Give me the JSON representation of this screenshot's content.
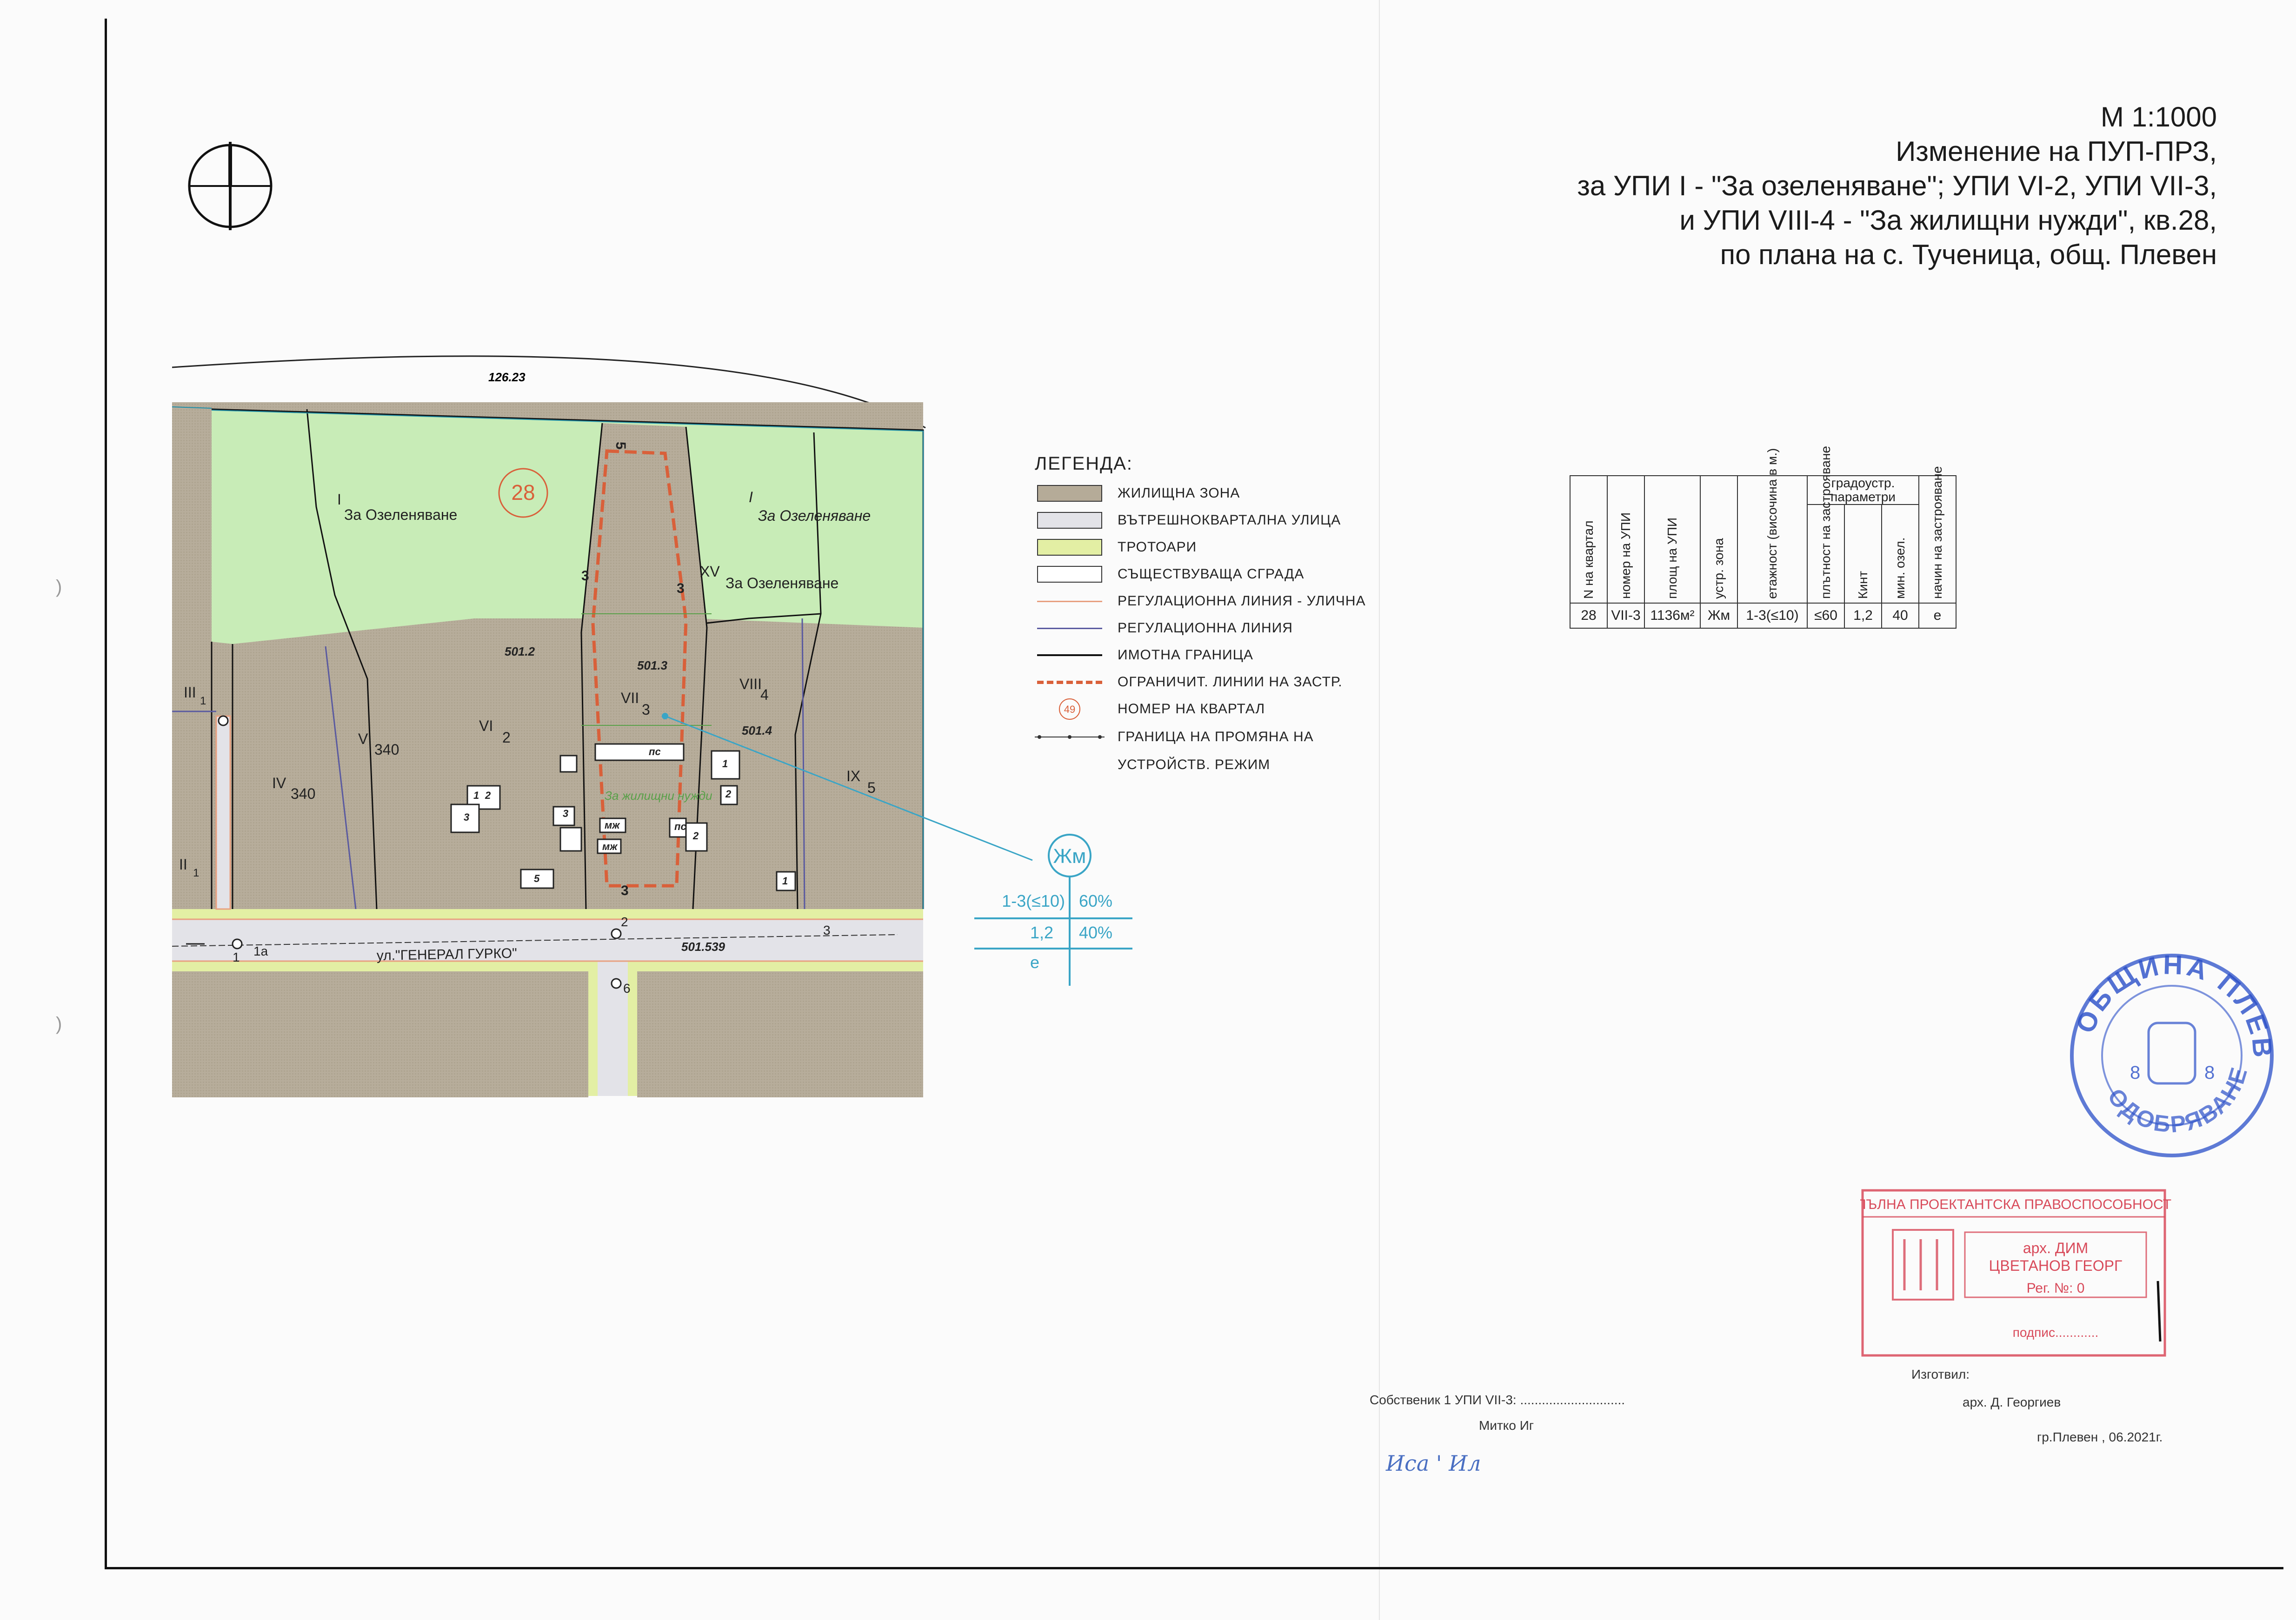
{
  "title": {
    "scale": "М 1:1000",
    "line1": "Изменение на ПУП-ПРЗ,",
    "line2": "за  УПИ I - \"За озеленяване\"; УПИ VI-2, УПИ VII-3,",
    "line3": "и УПИ VIII-4 - \"За жилищни нужди\", кв.28,",
    "line4": "по плана на с. Тученица, общ. Плевен"
  },
  "colors": {
    "residential": "#b5ab98",
    "street": "#e3e3e8",
    "sidewalk": "#e3efa4",
    "greenery": "#c8ecb7",
    "regulation_street": "#e8a080",
    "regulation": "#5a5aa0",
    "property": "#111111",
    "build_limit": "#d9603a",
    "block_number": "#d9603a",
    "annotation": "#3aa5c6",
    "stamp": "#2a4fc8",
    "stamp_red": "#d84a5a"
  },
  "map": {
    "top_dimension": "126.23",
    "block_number": "28",
    "lots": [
      {
        "id": "lot-I-left",
        "roman": "I",
        "name": "За Озеленяване"
      },
      {
        "id": "lot-I-right",
        "roman": "I",
        "name": "За Озеленяване"
      },
      {
        "id": "lot-XV",
        "roman": "XV",
        "name": "За Озеленяване"
      },
      {
        "id": "lot-III",
        "roman": "III",
        "sub": "1"
      },
      {
        "id": "lot-II",
        "roman": "II",
        "sub": "1"
      },
      {
        "id": "lot-IV",
        "roman": "IV",
        "sub": "340"
      },
      {
        "id": "lot-V",
        "roman": "V",
        "sub": "340"
      },
      {
        "id": "lot-VI",
        "roman": "VI",
        "sub": "2"
      },
      {
        "id": "lot-VII",
        "roman": "VII",
        "sub": "3"
      },
      {
        "id": "lot-VIII",
        "roman": "VIII",
        "sub": "4"
      },
      {
        "id": "lot-IX",
        "roman": "IX",
        "sub": "5"
      }
    ],
    "elevations": [
      "501.2",
      "501.3",
      "501.4",
      "501.539"
    ],
    "dims": {
      "top": "5",
      "left": "3",
      "right": "3",
      "bottom": "3"
    },
    "zone_label": "За жилищни нужди",
    "building_tags": [
      "пс",
      "пс",
      "мж",
      "мж"
    ],
    "building_numbers": [
      "1",
      "2",
      "1",
      "2",
      "3",
      "1",
      "2",
      "3",
      "5"
    ],
    "street": "ул.\"ГЕНЕРАЛ ГУРКО\"",
    "points": {
      "p1": "1",
      "p1a": "1а",
      "p2": "2",
      "p3": "3",
      "p6": "6"
    }
  },
  "zone_marker": {
    "zone": "Жм",
    "floors": "1-3(≤10)",
    "density": "60%",
    "kint": "1,2",
    "green": "40%",
    "mode": "е"
  },
  "legend": {
    "title": "ЛЕГЕНДА:",
    "items": [
      {
        "key": "residential",
        "label": "ЖИЛИЩНА ЗОНА"
      },
      {
        "key": "street",
        "label": "ВЪТРЕШНОКВАРТАЛНА УЛИЦА"
      },
      {
        "key": "sidewalk",
        "label": "ТРОТОАРИ"
      },
      {
        "key": "building",
        "label": "СЪЩЕСТВУВАЩА СГРАДА"
      },
      {
        "key": "regulation_street",
        "label": "РЕГУЛАЦИОННА ЛИНИЯ - УЛИЧНА"
      },
      {
        "key": "regulation",
        "label": "РЕГУЛАЦИОННА ЛИНИЯ"
      },
      {
        "key": "property",
        "label": "ИМОТНА ГРАНИЦА"
      },
      {
        "key": "build_limit",
        "label": "ОГРАНИЧИТ. ЛИНИИ НА ЗАСТР."
      },
      {
        "key": "block",
        "label": "НОМЕР НА КВАРТАЛ",
        "symbol_text": "49"
      },
      {
        "key": "change",
        "label": "ГРАНИЦА НА ПРОМЯНА НА",
        "label2": "УСТРОЙСТВ. РЕЖИМ"
      }
    ]
  },
  "param_table": {
    "headers": [
      "N на квартал",
      "номер на УПИ",
      "площ на УПИ",
      "устр. зона",
      "етажност (височина в м.)"
    ],
    "group_header": "градоустр. параметри",
    "sub_headers": [
      "плътност на застрояване",
      "Кинт",
      "мин. озел.",
      "начин на застрояване"
    ],
    "row": [
      "28",
      "VII-3",
      "1136м²",
      "Жм",
      "1-3(≤10)",
      "≤60",
      "1,2",
      "40",
      "е"
    ]
  },
  "signatures": {
    "owner": "Собственик 1 УПИ VII-3: .............................",
    "owner_name": "Митко Иг",
    "owner_hand": "Иса  ' Ил",
    "made_by": "Изготвил:",
    "architect": "арх. Д. Георгиев",
    "place_date": "гр.Плевен , 06.2021г."
  },
  "stamps": {
    "round_text": "ОБЩИНА ПЛЕВЕН",
    "round_bottom": "ОДОБРЯВАНЕ",
    "round_num": "8",
    "rect_header": "ПЪЛНА ПРОЕКТАНТСКА ПРАВОСПОСОБНОСТ",
    "rect_title": "арх. ДИМ",
    "rect_name": "ЦВЕТАНОВ ГЕОРГ",
    "rect_reg": "Рег. №: 0",
    "rect_sign": "подпис............"
  }
}
